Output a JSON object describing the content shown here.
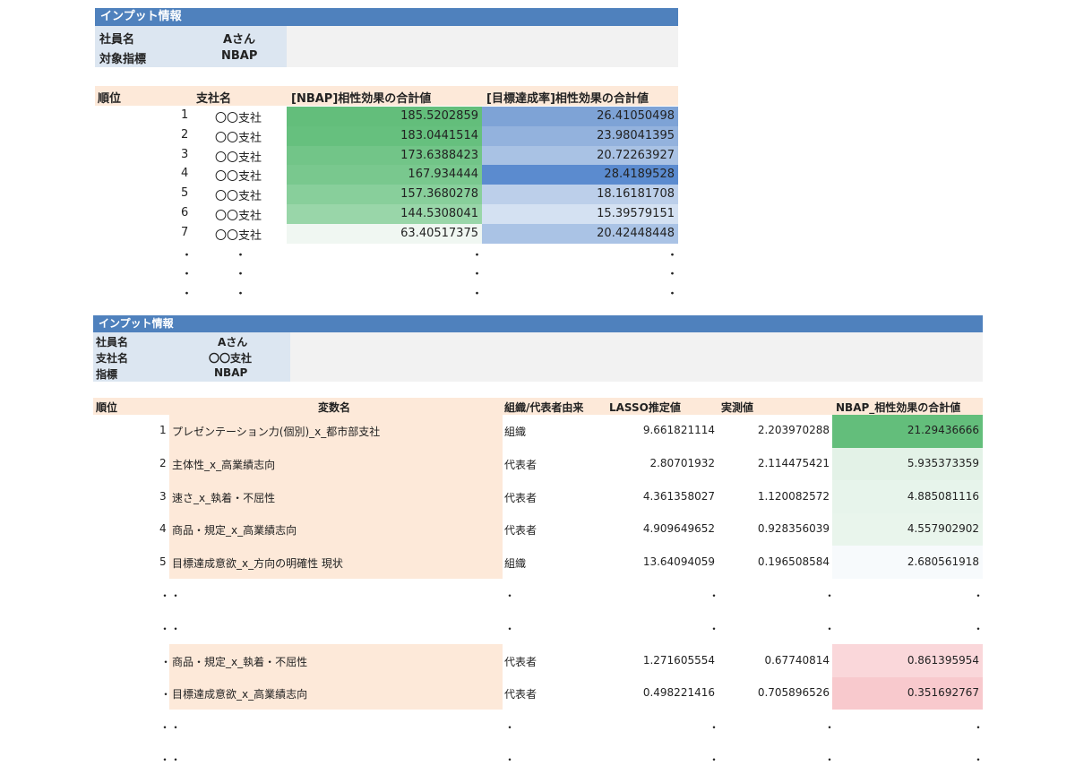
{
  "section1": {
    "header": "インプット情報",
    "inputs": [
      {
        "label": "社員名",
        "value": "Aさん"
      },
      {
        "label": "対象指標",
        "value": "NBAP"
      }
    ],
    "columns": [
      "順位",
      "支社名",
      "[NBAP]相性効果の合計値",
      "[目標達成率]相性効果の合計値"
    ],
    "rows": [
      {
        "rank": "1",
        "branch": "〇〇支社",
        "nbap": "185.5202859",
        "target": "26.41050498"
      },
      {
        "rank": "2",
        "branch": "〇〇支社",
        "nbap": "183.0441514",
        "target": "23.98041395"
      },
      {
        "rank": "3",
        "branch": "〇〇支社",
        "nbap": "173.6388423",
        "target": "20.72263927"
      },
      {
        "rank": "4",
        "branch": "〇〇支社",
        "nbap": "167.934444",
        "target": "28.4189528"
      },
      {
        "rank": "5",
        "branch": "〇〇支社",
        "nbap": "157.3680278",
        "target": "18.16181708"
      },
      {
        "rank": "6",
        "branch": "〇〇支社",
        "nbap": "144.5308041",
        "target": "15.39579151"
      },
      {
        "rank": "7",
        "branch": "〇〇支社",
        "nbap": "63.40517375",
        "target": "20.42448448"
      }
    ],
    "ellipsis": "・"
  },
  "section2": {
    "header": "インプット情報",
    "inputs": [
      {
        "label": "社員名",
        "value": "Aさん"
      },
      {
        "label": "支社名",
        "value": "〇〇支社"
      },
      {
        "label": "指標",
        "value": "NBAP"
      }
    ],
    "columns": [
      "順位",
      "変数名",
      "組織/代表者由来",
      "LASSO推定値",
      "実測値",
      "NBAP_相性効果の合計値"
    ],
    "rows": [
      {
        "rank": "1",
        "var": "プレゼンテーション力(個別)_x_都市部支社",
        "origin": "組織",
        "lasso": "9.661821114",
        "actual": "2.203970288",
        "total": "21.29436666"
      },
      {
        "rank": "2",
        "var": "主体性_x_高業績志向",
        "origin": "代表者",
        "lasso": "2.80701932",
        "actual": "2.114475421",
        "total": "5.935373359"
      },
      {
        "rank": "3",
        "var": "速さ_x_執着・不屈性",
        "origin": "代表者",
        "lasso": "4.361358027",
        "actual": "1.120082572",
        "total": "4.885081116"
      },
      {
        "rank": "4",
        "var": "商品・規定_x_高業績志向",
        "origin": "代表者",
        "lasso": "4.909649652",
        "actual": "0.928356039",
        "total": "4.557902902"
      },
      {
        "rank": "5",
        "var": "目標達成意欲_x_方向の明確性 現状",
        "origin": "組織",
        "lasso": "13.64094059",
        "actual": "0.196508584",
        "total": "2.680561918"
      }
    ],
    "bottom_rows": [
      {
        "rank": "・",
        "var": "商品・規定_x_執着・不屈性",
        "origin": "代表者",
        "lasso": "1.271605554",
        "actual": "0.67740814",
        "total": "0.861395954"
      },
      {
        "rank": "・",
        "var": "目標達成意欲_x_高業績志向",
        "origin": "代表者",
        "lasso": "0.498221416",
        "actual": "0.705896526",
        "total": "0.351692767"
      }
    ],
    "ellipsis": "・",
    "ellipsis_double": "・・"
  },
  "colors": {
    "header_blue": "#4f81bd",
    "label_blue": "#dce6f1",
    "input_gray": "#f2f2f2",
    "peach": "#fde9d9",
    "nbap_scale": [
      "#63be7b",
      "#66c07e",
      "#72c588",
      "#79c88e",
      "#88cf9b",
      "#99d6a9",
      "#f0f7f2"
    ],
    "target_scale": [
      "#7ea3d6",
      "#93b2dd",
      "#a9c2e4",
      "#5b8bcf",
      "#bccfea",
      "#d4e1f2",
      "#aac3e5"
    ],
    "total_scale": [
      "#63be7b",
      "#e3f2e7",
      "#e7f4eb",
      "#e9f5ec",
      "#f7fafc"
    ],
    "total_bottom": [
      "#fad7da",
      "#f8c9cd"
    ]
  }
}
